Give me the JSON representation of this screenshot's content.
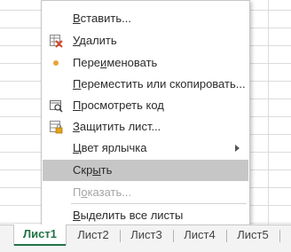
{
  "menu": {
    "items": [
      {
        "label_u": "В",
        "label_rest": "ставить...",
        "icon": "none",
        "enabled": true,
        "selected": false
      },
      {
        "label_u": "У",
        "label_rest": "далить",
        "icon": "delete-sheet-icon",
        "enabled": true,
        "selected": false
      },
      {
        "label_pre": "Пере",
        "label_u": "и",
        "label_rest": "меновать",
        "icon": "bullet-icon",
        "enabled": true,
        "selected": false
      },
      {
        "label_u": "П",
        "label_rest": "ереместить или скопировать...",
        "icon": "none",
        "enabled": true,
        "selected": false
      },
      {
        "label_u": "П",
        "label_rest": "росмотреть код",
        "icon": "view-code-icon",
        "enabled": true,
        "selected": false
      },
      {
        "label_u": "З",
        "label_rest": "ащитить лист...",
        "icon": "protect-sheet-icon",
        "enabled": true,
        "selected": false
      },
      {
        "label_u": "Ц",
        "label_rest": "вет ярлычка",
        "icon": "none",
        "enabled": true,
        "selected": false,
        "submenu": true
      },
      {
        "label_pre": "Скр",
        "label_u": "ы",
        "label_rest": "ть",
        "icon": "none",
        "enabled": true,
        "selected": true
      },
      {
        "label_pre": "П",
        "label_u": "о",
        "label_rest": "казать...",
        "icon": "none",
        "enabled": false,
        "selected": false
      },
      {
        "label_u": "В",
        "label_rest": "ыделить все листы",
        "icon": "none",
        "enabled": true,
        "selected": false
      }
    ]
  },
  "tabs": [
    {
      "label": "Лист1",
      "active": true
    },
    {
      "label": "Лист2",
      "active": false
    },
    {
      "label": "Лист3",
      "active": false
    },
    {
      "label": "Лист4",
      "active": false
    },
    {
      "label": "Лист5",
      "active": false
    }
  ],
  "colors": {
    "accent": "#217346",
    "selected_bg": "#c6c6c6",
    "disabled_text": "#a6a6a6"
  }
}
